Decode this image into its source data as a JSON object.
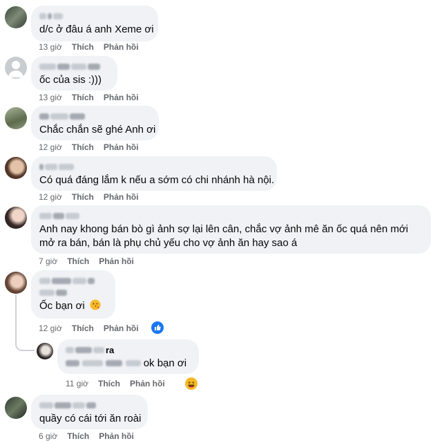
{
  "labels": {
    "like": "Thích",
    "reply": "Phản hồi"
  },
  "comments": [
    {
      "text": "d/c ở đâu á anh Xeme ơi",
      "time": "13 giờ"
    },
    {
      "text": "ốc của sis :)))",
      "time": "13 giờ"
    },
    {
      "text": "Chắc chắn sẽ ghé Anh ơi",
      "time": "12 giờ"
    },
    {
      "text": "Có quá đáng lắm k nếu a sớm có chi nhánh hà nội.",
      "time": "12 giờ"
    },
    {
      "text": "Anh nay khong bán bò gì ảnh sợ lại lên cân, chắc vợ ảnh mê ăn ốc quá nên mới mở ra bán, bán là phụ chủ yếu cho vợ ảnh ăn hay sao á",
      "time": "7 giờ"
    },
    {
      "text": "Ốc bạn ơi",
      "time": "12 giờ",
      "reaction": "like"
    },
    {
      "name_suffix": "ra",
      "text": "ok bạn ơi",
      "time": "11 giờ",
      "reaction": "haha"
    },
    {
      "text": "quầy có cái tới ăn roài",
      "time": "6 giờ"
    }
  ],
  "icons": {
    "like_reaction": "like-reaction-icon",
    "haha_reaction": "haha-reaction-icon",
    "kiss_emoji": "kiss-emoji-icon"
  },
  "colors": {
    "bubble": "#f0f2f5",
    "meta": "#65676b",
    "like_blue": "#1877f2",
    "haha_yellow": "#f7b928"
  }
}
